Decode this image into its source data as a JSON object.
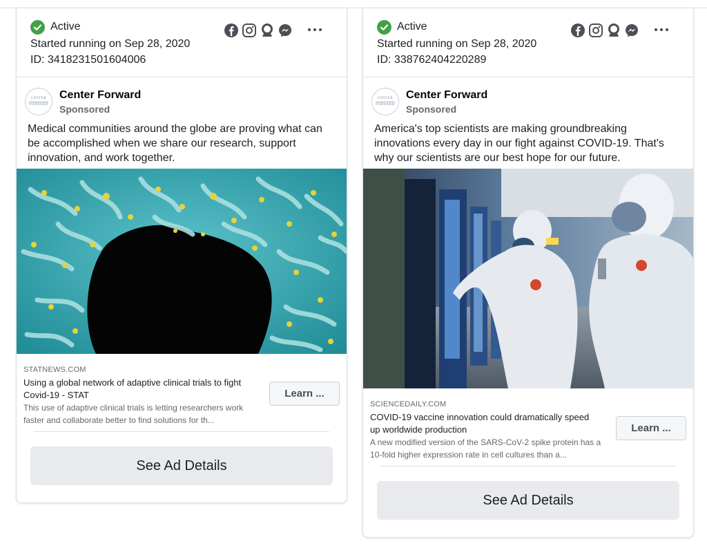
{
  "cards": [
    {
      "status": "Active",
      "started": "Started running on Sep 28, 2020",
      "id_text": "ID: 3418231501604006",
      "platforms": [
        "facebook-icon",
        "instagram-icon",
        "audience-network-icon",
        "messenger-icon"
      ],
      "advertiser": {
        "name": "Center Forward",
        "sponsored": "Sponsored",
        "logo_line1": "CENTER",
        "logo_line2": "FORWARD"
      },
      "body": "Medical communities around the globe are proving what can be accomplished when we share our research, support innovation, and work together.",
      "image_subject": "virus-micrograph",
      "link": {
        "domain": "STATNEWS.COM",
        "title": "Using a global network of adaptive clinical trials to fight Covid-19 - STAT",
        "description": "This use of adaptive clinical trials is letting researchers work faster and collaborate better to find solutions for th..."
      },
      "cta": "Learn ...",
      "details_button": "See Ad Details"
    },
    {
      "status": "Active",
      "started": "Started running on Sep 28, 2020",
      "id_text": "ID: 338762404220289",
      "platforms": [
        "facebook-icon",
        "instagram-icon",
        "audience-network-icon",
        "messenger-icon"
      ],
      "advertiser": {
        "name": "Center Forward",
        "sponsored": "Sponsored",
        "logo_line1": "CENTER",
        "logo_line2": "FORWARD"
      },
      "body": "America's top scientists are making groundbreaking innovations every day in our fight against COVID-19. That's why our scientists are our best hope for our future.",
      "image_subject": "workers-in-protective-suits",
      "link": {
        "domain": "SCIENCEDAILY.COM",
        "title": "COVID-19 vaccine innovation could dramatically speed up worldwide production",
        "description": "A new modified version of the SARS-CoV-2 spike protein has a 10-fold higher expression rate in cell cultures than a..."
      },
      "cta": "Learn ...",
      "details_button": "See Ad Details"
    }
  ],
  "colors": {
    "active_green": "#43a047",
    "details_bg": "#e9eaed",
    "muted_text": "#65676b"
  }
}
